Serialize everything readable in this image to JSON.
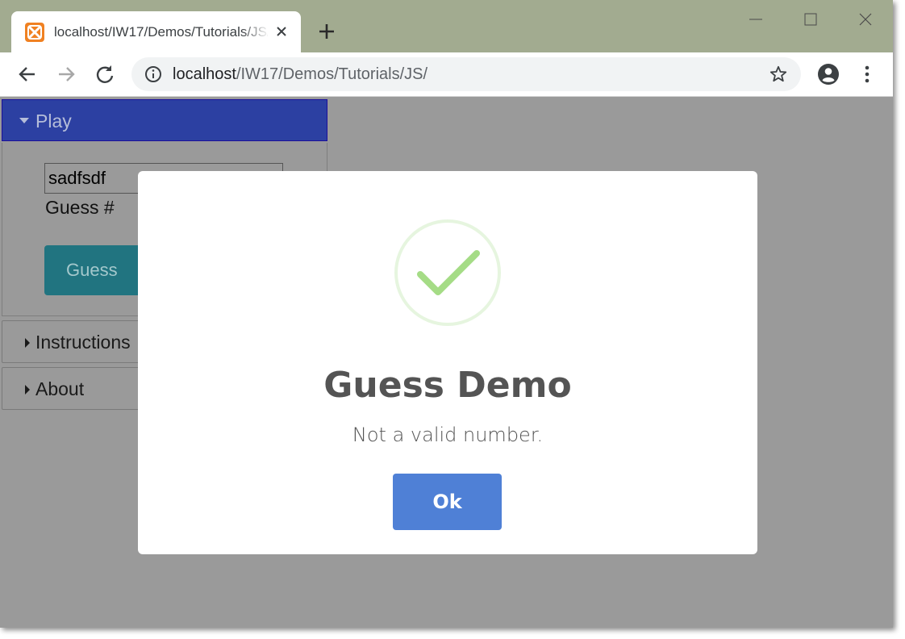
{
  "browser": {
    "tab_title": "localhost/IW17/Demos/Tutorials/JS/",
    "url_host": "localhost",
    "url_path": "/IW17/Demos/Tutorials/JS/",
    "icons": [
      "xampp-favicon",
      "close-tab-icon",
      "new-tab-icon",
      "minimize-icon",
      "maximize-icon",
      "close-window-icon",
      "back-icon",
      "forward-icon",
      "reload-icon",
      "info-icon",
      "star-icon",
      "account-icon",
      "menu-icon"
    ]
  },
  "accordion": {
    "play_label": "Play",
    "guess_value": "sadfsdf",
    "guess_label": "Guess #",
    "guess_button": "Guess",
    "instructions_label": "Instructions",
    "about_label": "About"
  },
  "modal": {
    "title": "Guess Demo",
    "text": "Not a valid number.",
    "ok_label": "Ok",
    "icon": "success-check-icon"
  },
  "colors": {
    "tabbar": "#a2ab90",
    "accordion_active": "#2c40a2",
    "guess_button": "#217480",
    "ok_button": "#4f80d6",
    "check": "#a5dc86"
  }
}
